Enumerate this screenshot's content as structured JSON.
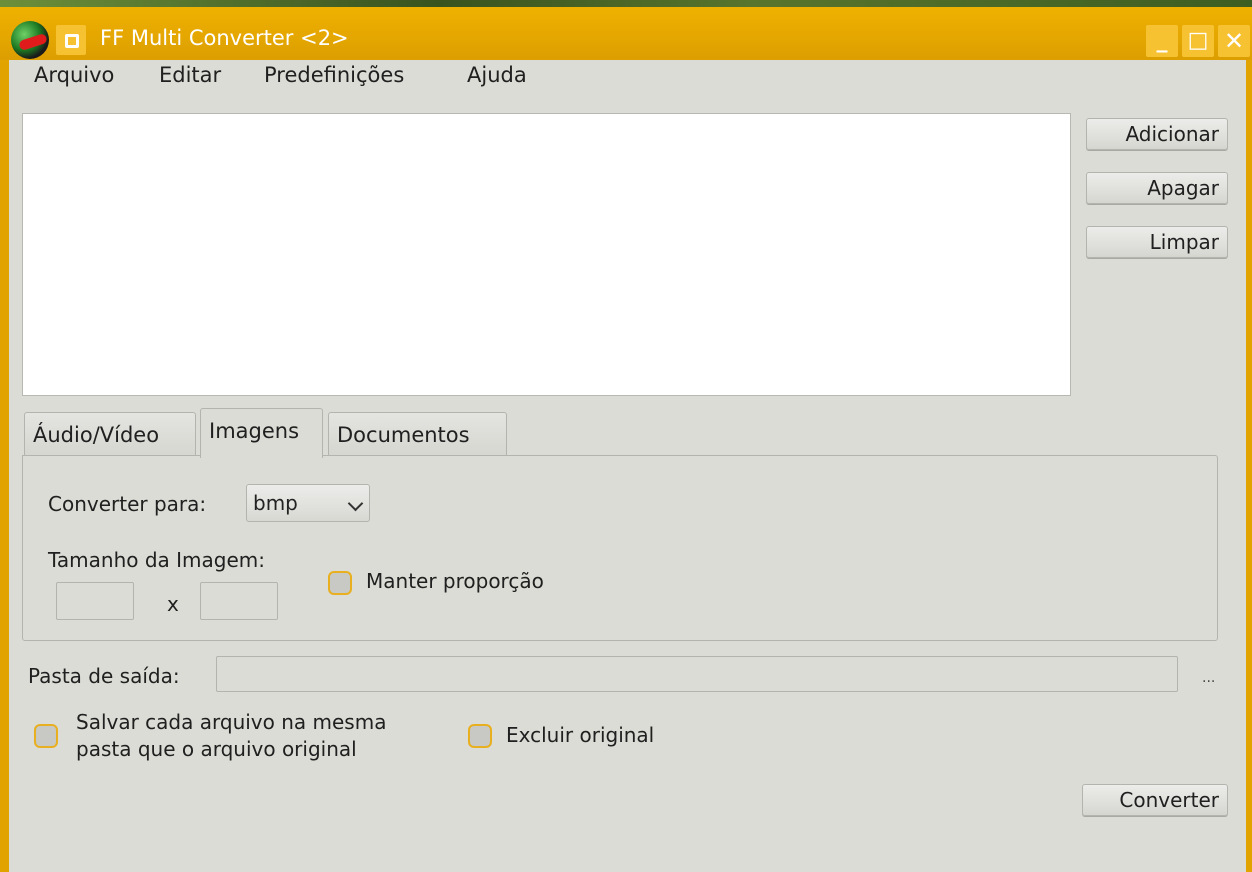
{
  "window": {
    "title": "FF Multi Converter <2>"
  },
  "menu": {
    "items": [
      "Arquivo",
      "Editar",
      "Predefinições",
      "Ajuda"
    ]
  },
  "side_buttons": {
    "add": "Adicionar",
    "delete": "Apagar",
    "clear": "Limpar"
  },
  "tabs": {
    "audio_video": "Áudio/Vídeo",
    "images": "Imagens",
    "documents": "Documentos",
    "active": "Imagens"
  },
  "images_tab": {
    "convert_to_label": "Converter para:",
    "convert_to_value": "bmp",
    "image_size_label": "Tamanho da Imagem:",
    "width_value": "",
    "times": "x",
    "height_value": "",
    "keep_ratio_label": "Manter proporção"
  },
  "output": {
    "folder_label": "Pasta de saída:",
    "folder_value": "",
    "browse": "..."
  },
  "options": {
    "save_same_folder_line1": "Salvar cada arquivo na mesma",
    "save_same_folder_line2": "pasta que o arquivo original",
    "delete_original": "Excluir original"
  },
  "actions": {
    "convert": "Converter"
  },
  "colors": {
    "titlebar": "#e0a300",
    "window_bg": "#dcdcd6",
    "checkbox_border": "#e8b020"
  }
}
